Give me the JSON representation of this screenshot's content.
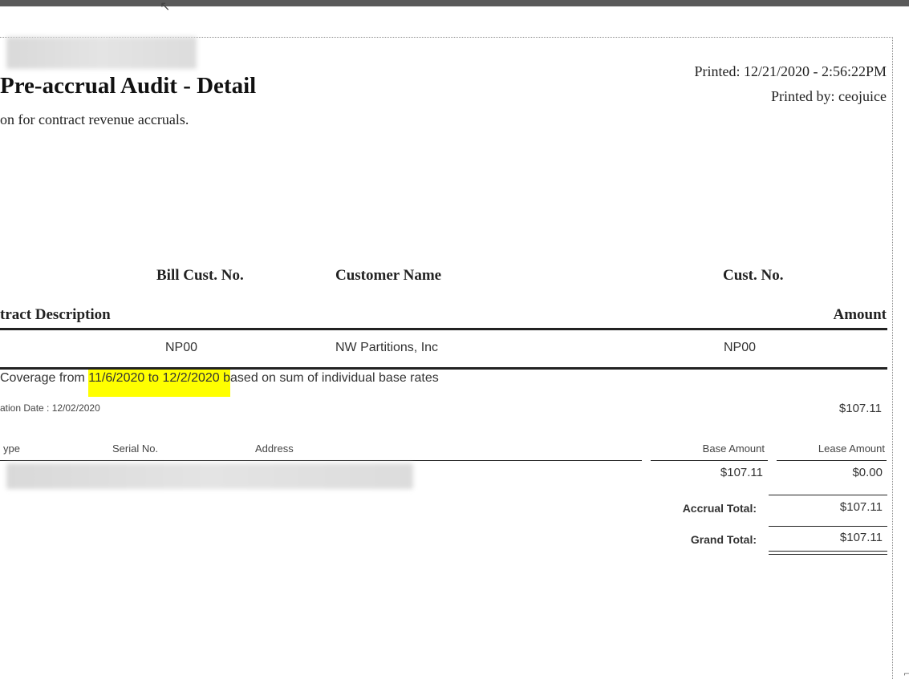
{
  "header": {
    "title": "Pre-accrual Audit - Detail",
    "subtitle": "on for contract revenue accruals.",
    "printed": "Printed: 12/21/2020 -  2:56:22PM",
    "printed_by": "Printed by: ceojuice"
  },
  "columns": {
    "bill_cust_no": "Bill Cust. No.",
    "customer_name": "Customer Name",
    "cust_no": "Cust. No.",
    "contract_description": "tract Description",
    "amount": "Amount"
  },
  "customer_row": {
    "bill_cust_no": "NP00",
    "customer_name": "NW Partitions, Inc",
    "cust_no": "NP00"
  },
  "coverage": {
    "before": " Coverage from ",
    "highlight": "11/6/2020 to 12/2/2020 b",
    "after": "ased on sum of individual base rates"
  },
  "expiration": {
    "label": "ation Date : 12/02/2020",
    "amount": "$107.11"
  },
  "detail_columns": {
    "type": "ype",
    "serial": "Serial No.",
    "address": "Address",
    "base_amount": "Base Amount",
    "lease_amount": "Lease Amount"
  },
  "detail_row": {
    "base_amount": "$107.11",
    "lease_amount": "$0.00"
  },
  "totals": {
    "accrual_label": "Accrual Total:",
    "accrual_value": "$107.11",
    "grand_label": "Grand Total:",
    "grand_value": "$107.11"
  },
  "icons": {
    "cursor": "mouse-pointer-icon"
  }
}
